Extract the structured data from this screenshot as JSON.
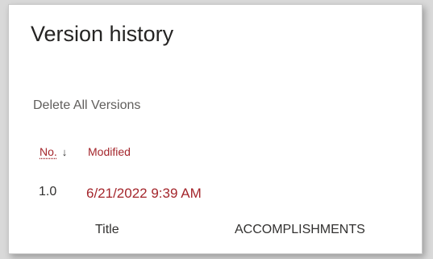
{
  "dialog": {
    "title": "Version history",
    "delete_all_label": "Delete All Versions"
  },
  "table": {
    "columns": {
      "no_label": "No.",
      "sort_icon": "↓",
      "modified_label": "Modified"
    },
    "rows": [
      {
        "no": "1.0",
        "modified": "6/21/2022 9:39 AM",
        "fields": [
          {
            "name": "Title",
            "value": "ACCOMPLISHMENTS"
          }
        ]
      }
    ]
  },
  "colors": {
    "accent": "#a4262c",
    "text": "#323130",
    "muted": "#605e5c"
  }
}
